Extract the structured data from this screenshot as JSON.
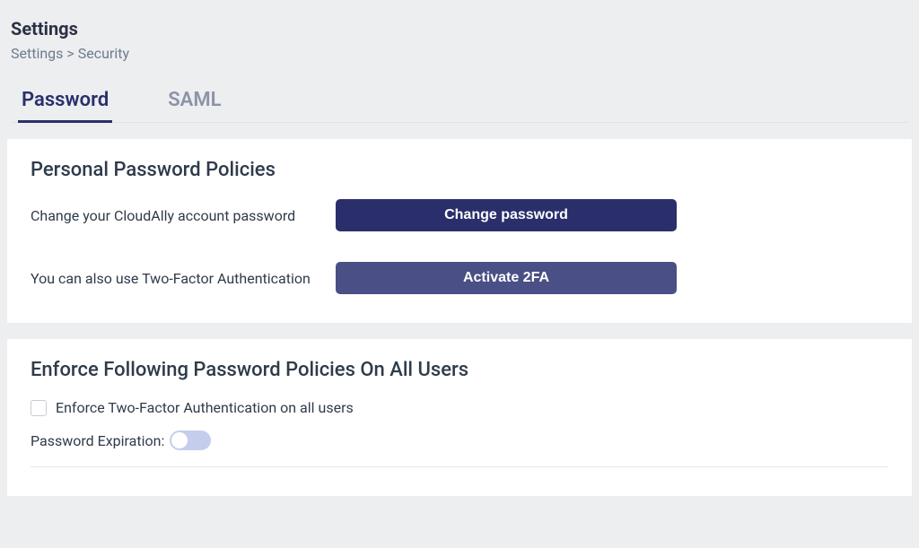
{
  "header": {
    "title": "Settings",
    "breadcrumb": "Settings > Security"
  },
  "tabs": {
    "password": "Password",
    "saml": "SAML"
  },
  "personal": {
    "title": "Personal Password Policies",
    "change_label": "Change your CloudAlly account password",
    "change_button": "Change password",
    "twofa_label": "You can also use Two-Factor Authentication",
    "twofa_button": "Activate 2FA"
  },
  "enforce": {
    "title": "Enforce Following Password Policies On All Users",
    "checkbox_label": "Enforce Two-Factor Authentication on all users",
    "expiration_label": "Password Expiration:"
  }
}
